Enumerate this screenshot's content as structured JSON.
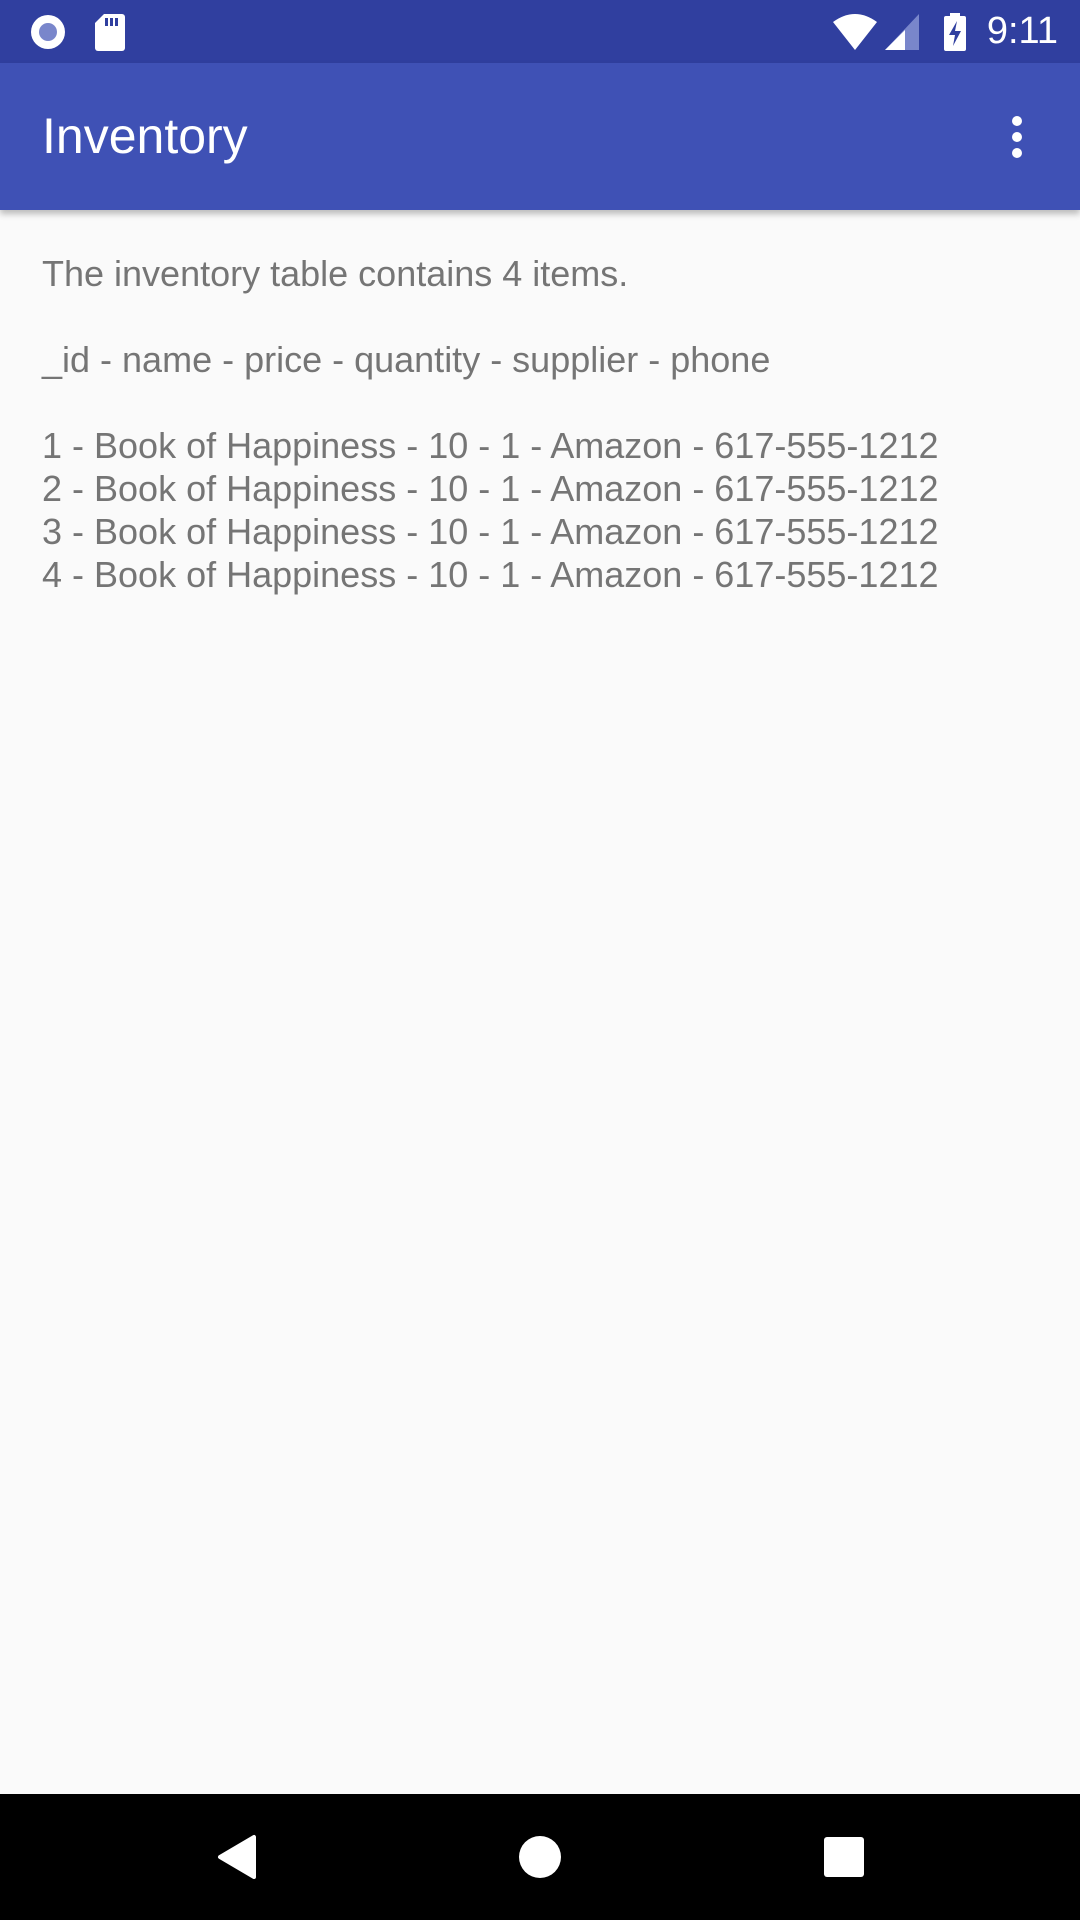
{
  "status_bar": {
    "time": "9:11",
    "icons": [
      "radio-icon",
      "sd-card-icon",
      "wifi-icon",
      "signal-icon",
      "battery-charging-icon"
    ]
  },
  "app_bar": {
    "title": "Inventory",
    "overflow_icon": "more-vert-icon"
  },
  "content": {
    "summary": "The inventory table contains 4 items.",
    "header": "_id - name - price - quantity - supplier - phone",
    "rows": [
      "1 - Book of Happiness - 10 - 1 - Amazon - 617-555-1212",
      "2 - Book of Happiness - 10 - 1 - Amazon - 617-555-1212",
      "3 - Book of Happiness - 10 - 1 - Amazon - 617-555-1212",
      "4 - Book of Happiness - 10 - 1 - Amazon - 617-555-1212"
    ]
  },
  "nav_bar": {
    "buttons": [
      "back-icon",
      "home-icon",
      "recents-icon"
    ]
  },
  "colors": {
    "status_bar": "#303f9f",
    "app_bar": "#3f51b5",
    "background": "#fafafa",
    "text": "#757575"
  }
}
